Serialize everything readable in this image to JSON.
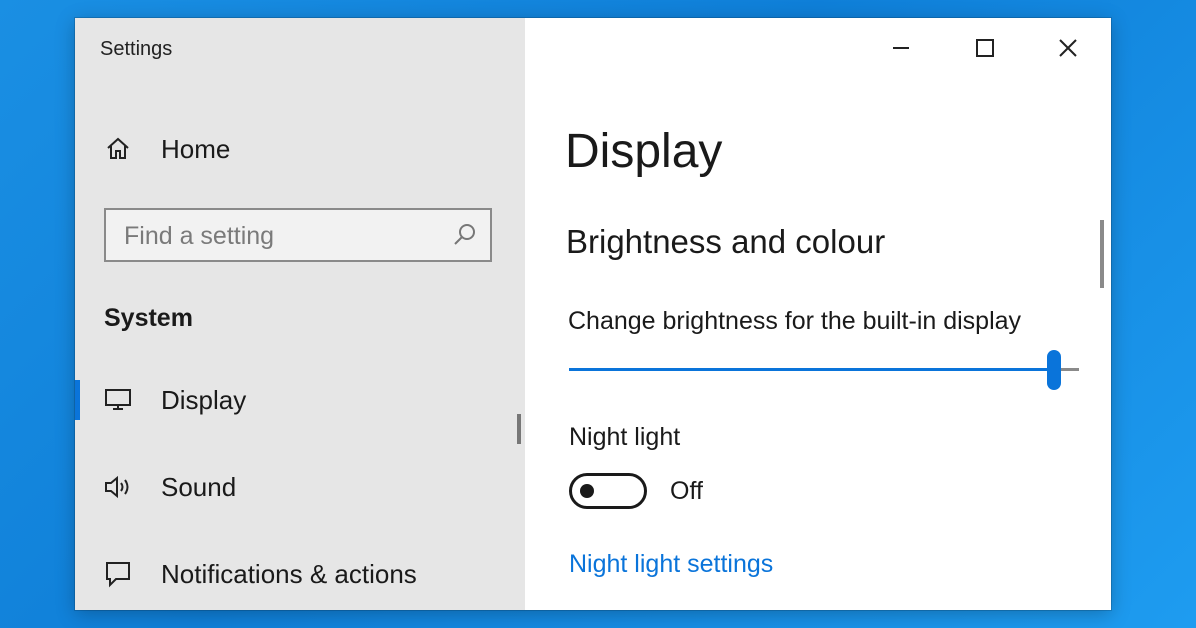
{
  "window": {
    "title": "Settings",
    "controls": {
      "minimize": "minimize",
      "maximize": "maximize",
      "close": "close"
    }
  },
  "sidebar": {
    "home": {
      "label": "Home",
      "icon": "home-icon"
    },
    "search": {
      "placeholder": "Find a setting",
      "value": "",
      "icon": "search-icon"
    },
    "section_title": "System",
    "items": [
      {
        "label": "Display",
        "icon": "monitor-icon",
        "selected": true
      },
      {
        "label": "Sound",
        "icon": "speaker-icon",
        "selected": false
      },
      {
        "label": "Notifications & actions",
        "icon": "notification-icon",
        "selected": false
      }
    ]
  },
  "main": {
    "page_title": "Display",
    "section": "Brightness and colour",
    "brightness": {
      "label": "Change brightness for the built-in display",
      "value_percent": 95
    },
    "night_light": {
      "label": "Night light",
      "state": "Off",
      "enabled": false
    },
    "link": "Night light settings"
  },
  "colors": {
    "accent": "#0a74da",
    "sidebar_bg": "#e6e6e6",
    "link": "#0a74da",
    "desktop": "#1a8fe3"
  }
}
